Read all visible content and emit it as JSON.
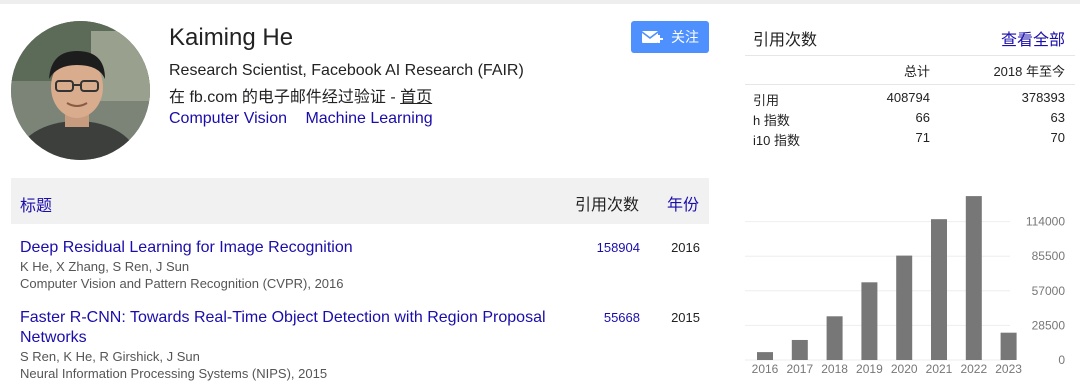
{
  "profile": {
    "name": "Kaiming He",
    "affiliation": "Research Scientist, Facebook AI Research (FAIR)",
    "email_verified_prefix": "在 fb.com 的电子邮件经过验证 - ",
    "homepage_label": "首页",
    "interests": [
      "Computer Vision",
      "Machine Learning"
    ],
    "follow_label": "关注"
  },
  "articles": {
    "header": {
      "title": "标题",
      "cited_by": "引用次数",
      "year": "年份"
    },
    "rows": [
      {
        "title": "Deep Residual Learning for Image Recognition",
        "authors": "K He, X Zhang, S Ren, J Sun",
        "venue": "Computer Vision and Pattern Recognition (CVPR), 2016",
        "cited_by": "158904",
        "year": "2016"
      },
      {
        "title": "Faster R-CNN: Towards Real-Time Object Detection with Region Proposal Networks",
        "authors": "S Ren, K He, R Girshick, J Sun",
        "venue": "Neural Information Processing Systems (NIPS), 2015",
        "cited_by": "55668",
        "year": "2015"
      }
    ]
  },
  "stats": {
    "title": "引用次数",
    "view_all": "查看全部",
    "columns": [
      "总计",
      "2018 年至今"
    ],
    "rows": [
      {
        "label": "引用",
        "total": "408794",
        "since": "378393"
      },
      {
        "label": "h 指数",
        "total": "66",
        "since": "63"
      },
      {
        "label": "i10 指数",
        "total": "71",
        "since": "70"
      }
    ]
  },
  "chart_data": {
    "type": "bar",
    "categories": [
      "2016",
      "2017",
      "2018",
      "2019",
      "2020",
      "2021",
      "2022",
      "2023"
    ],
    "values": [
      6500,
      16500,
      36000,
      64000,
      86000,
      116000,
      135000,
      22500
    ],
    "y_ticks": [
      "114000",
      "85500",
      "57000",
      "28500",
      "0"
    ],
    "ylim": [
      0,
      142500
    ],
    "bar_color": "#777777"
  },
  "colors": {
    "link": "#1a0dab",
    "button": "#4d90fe"
  }
}
